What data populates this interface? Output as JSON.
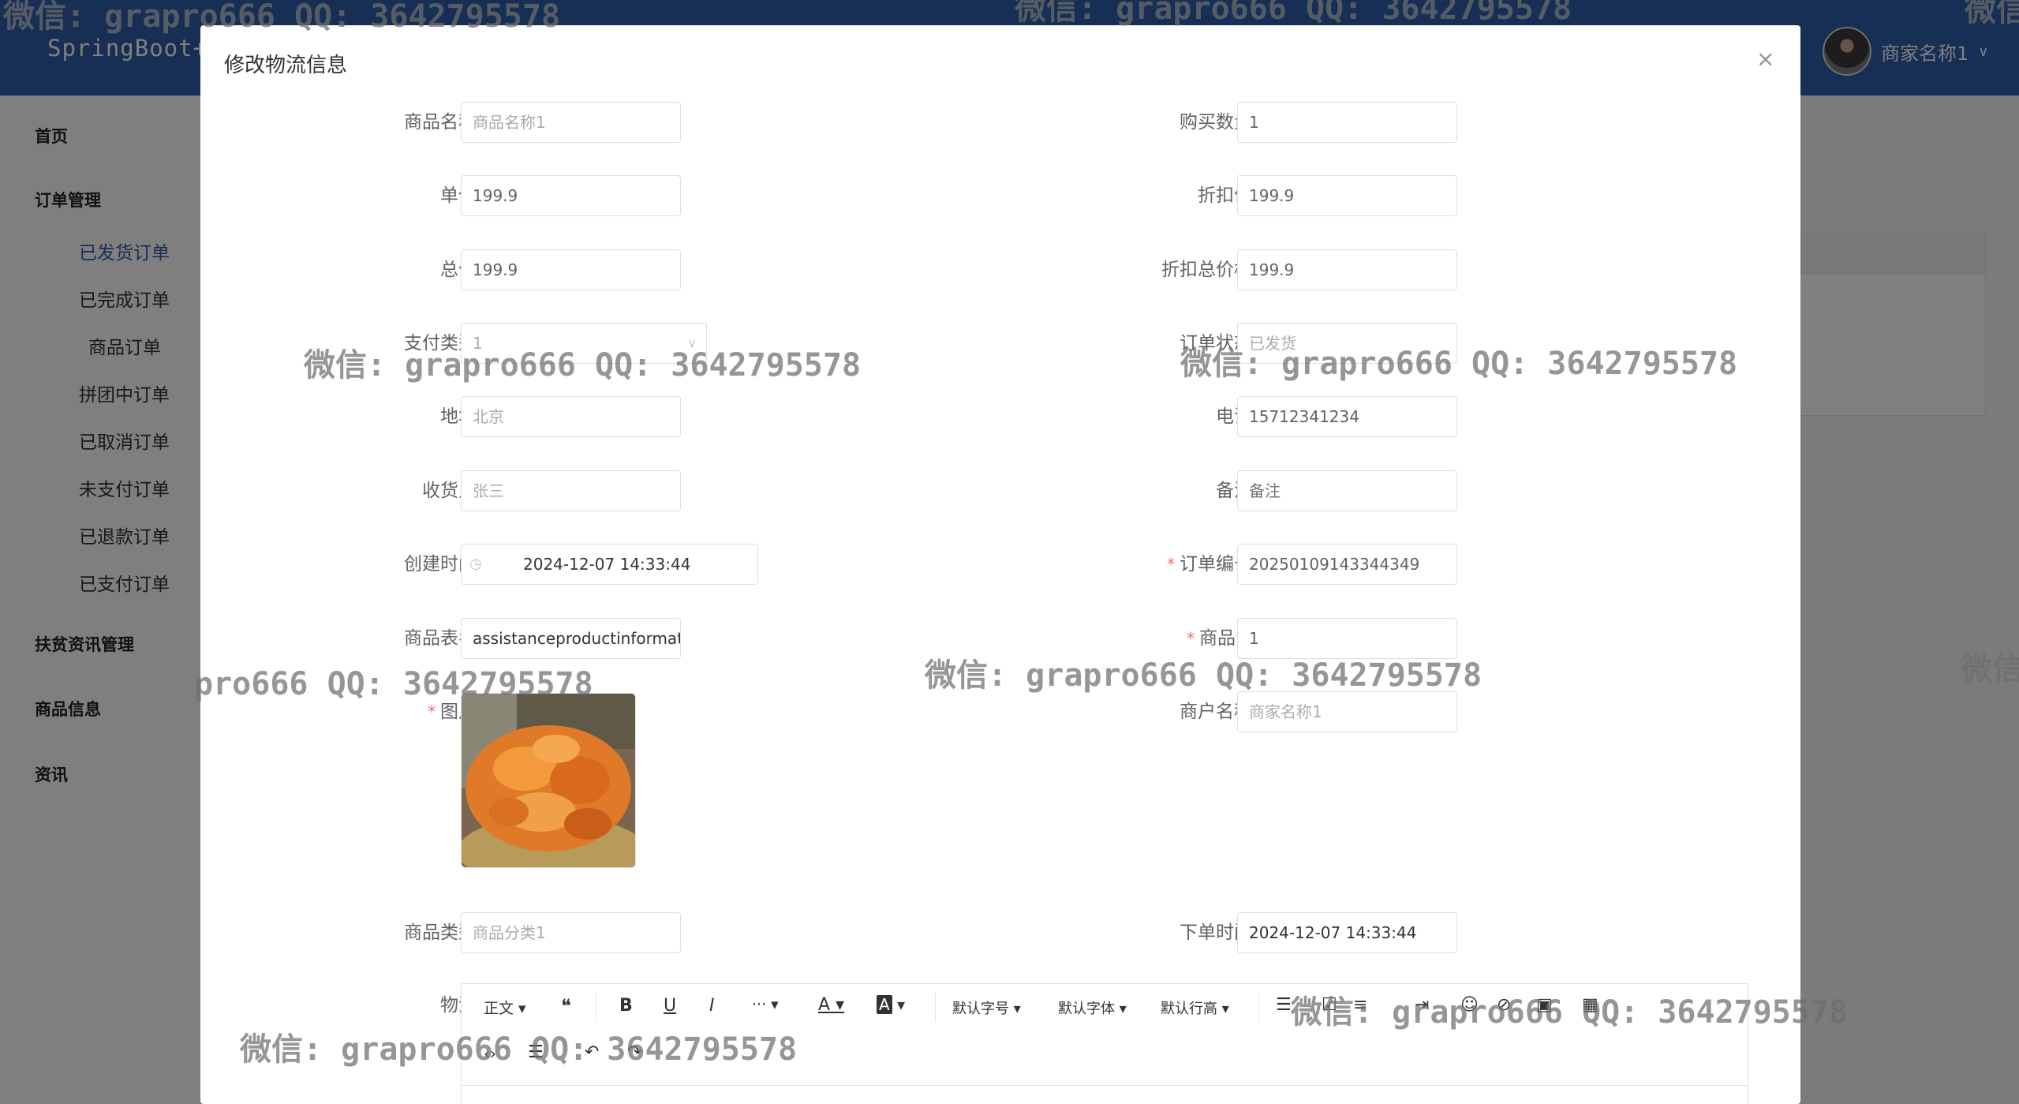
{
  "app": {
    "title": "SpringBoot+V",
    "user_name": "商家名称1",
    "user_chevron": "∨"
  },
  "sidebar": {
    "home": "首页",
    "order_management": "订单管理",
    "order_items": [
      "已发货订单",
      "已完成订单",
      "商品订单",
      "拼团中订单",
      "已取消订单",
      "未支付订单",
      "已退款订单",
      "已支付订单"
    ],
    "poverty_news": "扶贫资讯管理",
    "product_info": "商品信息",
    "news": "资讯"
  },
  "dialog": {
    "title": "修改物流信息",
    "close": "×",
    "fields": {
      "product_name": {
        "label": "商品名称",
        "value": "商品名称1"
      },
      "quantity": {
        "label": "购买数量",
        "value": "1"
      },
      "unit_price": {
        "label": "单价",
        "value": "199.9"
      },
      "discount_price": {
        "label": "折扣价",
        "value": "199.9"
      },
      "total_price": {
        "label": "总价",
        "value": "199.9"
      },
      "discount_total": {
        "label": "折扣总价格",
        "value": "199.9"
      },
      "pay_type": {
        "label": "支付类型",
        "value": "1"
      },
      "order_status": {
        "label": "订单状态",
        "value": "已发货"
      },
      "address": {
        "label": "地址",
        "value": "北京"
      },
      "phone": {
        "label": "电话",
        "value": "15712341234"
      },
      "receiver": {
        "label": "收货人",
        "value": "张三"
      },
      "remark": {
        "label": "备注",
        "placeholder": "备注"
      },
      "create_time": {
        "label": "创建时间",
        "value": "2024-12-07 14:33:44"
      },
      "order_no": {
        "label": "订单编号",
        "value": "20250109143344349",
        "required": "*"
      },
      "table_name": {
        "label": "商品表名",
        "value": "assistanceproductinformat"
      },
      "product_id": {
        "label": "商品id",
        "value": "1",
        "required": "*"
      },
      "image": {
        "label": "图片",
        "required": "*"
      },
      "merchant_name": {
        "label": "商户名称",
        "value": "商家名称1"
      },
      "product_type": {
        "label": "商品类型",
        "value": "商品分类1"
      },
      "order_time": {
        "label": "下单时间",
        "value": "2024-12-07 14:33:44"
      },
      "logistics": {
        "label": "物流"
      }
    },
    "editor": {
      "paragraph": "正文",
      "font_size": "默认字号",
      "font_family": "默认字体",
      "line_height": "默认行高",
      "more": "···",
      "font_color": "A",
      "bg_color": "A",
      "bold": "B",
      "underline": "U",
      "italic": "I",
      "quote": "❝"
    }
  },
  "watermark": "微信: grapro666 QQ: 3642795578",
  "watermark_partial_left": "pro666 QQ: 3642795578",
  "watermark_edge": "微信",
  "colors": {
    "header": "#2f5fa8",
    "active_menu": "#2f5fa8",
    "required": "#f56c6c",
    "overlay": "rgba(0,0,0,0.5)"
  }
}
